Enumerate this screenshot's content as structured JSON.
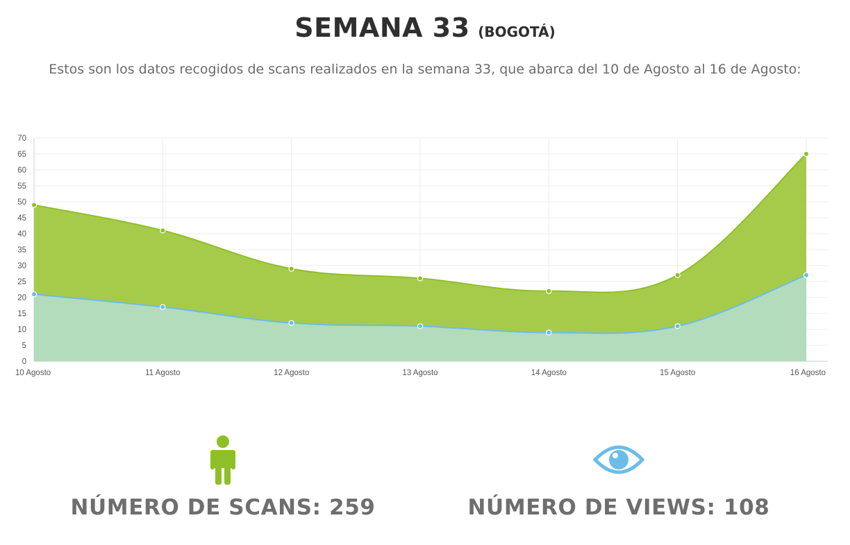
{
  "header": {
    "title": "SEMANA 33",
    "title_suffix": "(BOGOTÁ)",
    "subtitle": "Estos son los datos recogidos de scans realizados en la semana 33, que abarca del 10 de Agosto al 16 de Agosto:"
  },
  "stats": {
    "scans_label": "NÚMERO DE SCANS: 259",
    "views_label": "NÚMERO DE VIEWS: 108",
    "scans_icon": "person-icon",
    "views_icon": "eye-icon",
    "scans_color": "#8fbf26",
    "views_color": "#6bbde8"
  },
  "chart_data": {
    "type": "area",
    "categories": [
      "10 Agosto",
      "11 Agosto",
      "12 Agosto",
      "13 Agosto",
      "14 Agosto",
      "15 Agosto",
      "16 Agosto"
    ],
    "series": [
      {
        "values": [
          49,
          41,
          29,
          26,
          22,
          27,
          65
        ],
        "fill": "#a6cb4b",
        "stroke": "#8fbf26"
      },
      {
        "values": [
          21,
          17,
          12,
          11,
          9,
          11,
          27
        ],
        "fill": "#b2dcbb",
        "stroke": "#6bbde8"
      }
    ],
    "ylim": [
      0,
      70
    ],
    "yticks": [
      0,
      5,
      10,
      15,
      20,
      25,
      30,
      35,
      40,
      45,
      50,
      55,
      60,
      65,
      70
    ],
    "grid": true,
    "title": "",
    "xlabel": "",
    "ylabel": ""
  }
}
